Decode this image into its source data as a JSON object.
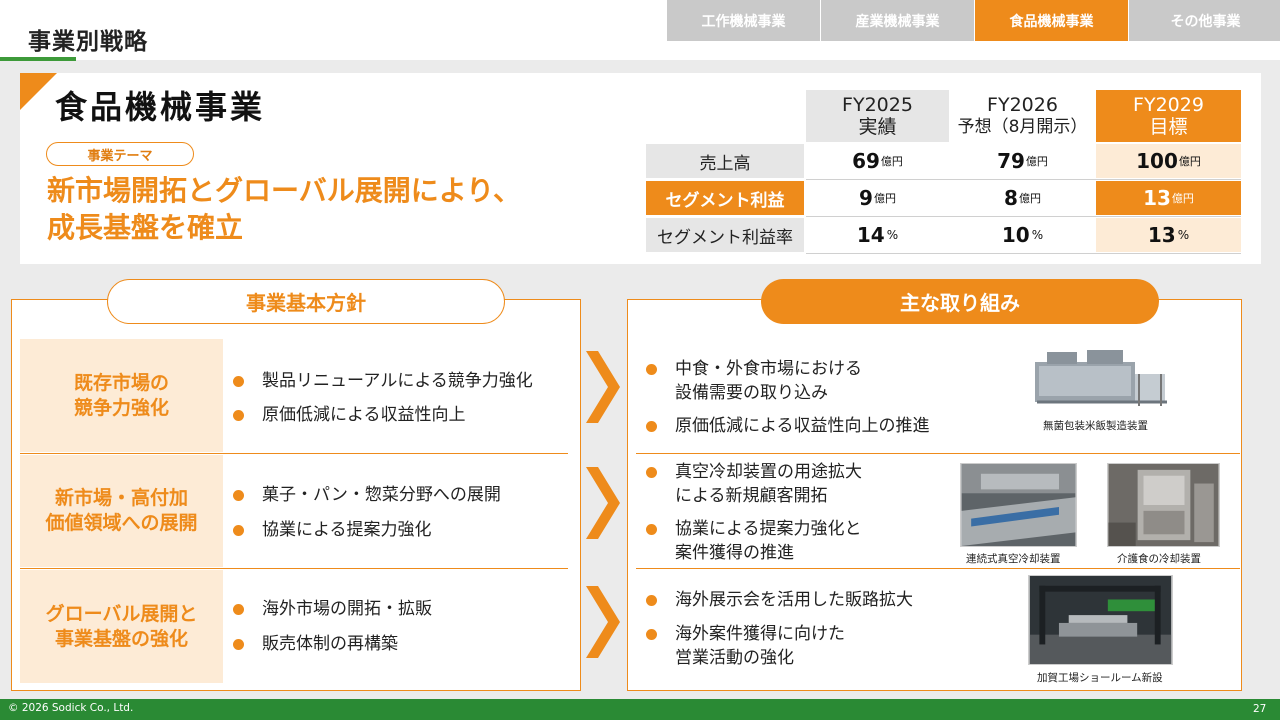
{
  "header": {
    "page_title": "事業別戦略",
    "tabs": [
      {
        "label": "工作機械事業"
      },
      {
        "label": "産業機械事業"
      },
      {
        "label": "食品機械事業"
      },
      {
        "label": "その他事業"
      }
    ]
  },
  "business": {
    "title": "食品機械事業",
    "theme_label": "事業テーマ",
    "theme_line1": "新市場開拓とグローバル展開により、",
    "theme_line2": "成長基盤を確立"
  },
  "kpi": {
    "columns": [
      {
        "year": "FY2025",
        "sub": "実績"
      },
      {
        "year": "FY2026",
        "sub": "予想（8月開示）"
      },
      {
        "year": "FY2029",
        "sub": "目標"
      }
    ],
    "rows": [
      {
        "label": "売上高",
        "values": [
          "69",
          "79",
          "100"
        ],
        "unit": "億円"
      },
      {
        "label": "セグメント利益",
        "values": [
          "9",
          "8",
          "13"
        ],
        "unit": "億円"
      },
      {
        "label": "セグメント利益率",
        "values": [
          "14",
          "10",
          "13"
        ],
        "unit": "%"
      }
    ]
  },
  "policy": {
    "heading": "事業基本方針",
    "rows": [
      {
        "label1": "既存市場の",
        "label2": "競争力強化",
        "bullets": [
          "製品リニューアルによる競争力強化",
          "原価低減による収益性向上"
        ]
      },
      {
        "label1": "新市場・高付加",
        "label2": "価値領域への展開",
        "bullets": [
          "菓子・パン・惣菜分野への展開",
          "協業による提案力強化"
        ]
      },
      {
        "label1": "グローバル展開と",
        "label2": "事業基盤の強化",
        "bullets": [
          "海外市場の開拓・拡販",
          "販売体制の再構築"
        ]
      }
    ]
  },
  "initiatives": {
    "heading": "主な取り組み",
    "rows": [
      {
        "bullets": [
          [
            "中食・外食市場における",
            "設備需要の取り込み"
          ],
          [
            "原価低減による収益性向上の推進"
          ]
        ],
        "captions": [
          "無菌包装米飯製造装置"
        ]
      },
      {
        "bullets": [
          [
            "真空冷却装置の用途拡大",
            "による新規顧客開拓"
          ],
          [
            "協業による提案力強化と",
            "案件獲得の推進"
          ]
        ],
        "captions": [
          "連続式真空冷却装置",
          "介護食の冷却装置"
        ]
      },
      {
        "bullets": [
          [
            "海外展示会を活用した販路拡大"
          ],
          [
            "海外案件獲得に向けた",
            "営業活動の強化"
          ]
        ],
        "captions": [
          "加賀工場ショールーム新設"
        ]
      }
    ]
  },
  "footer": {
    "copyright": "© 2026 Sodick Co., Ltd.",
    "page_number": "27"
  },
  "colors": {
    "accent": "#ee8b1b",
    "green": "#2a8a34",
    "tint": "#fdebd6"
  }
}
